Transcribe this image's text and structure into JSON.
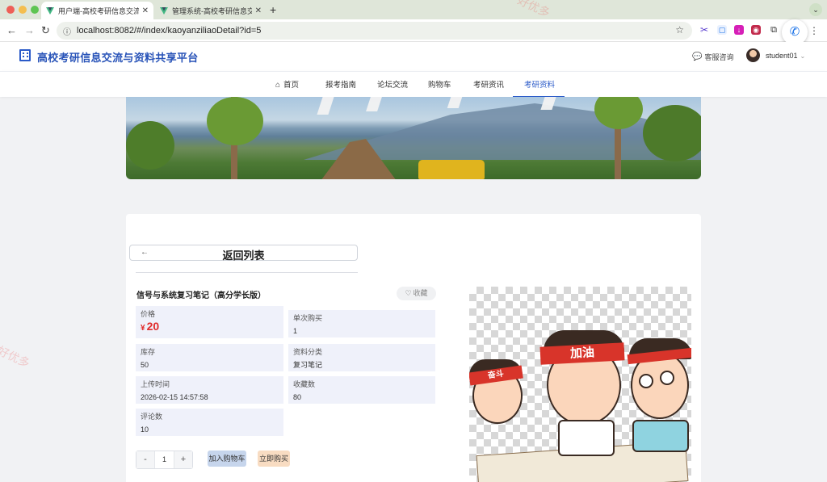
{
  "browser": {
    "tabs": [
      {
        "title": "用户端-高校考研信息交流与资料",
        "active": true
      },
      {
        "title": "管理系统-高校考研信息交流与资",
        "active": false
      }
    ],
    "new_tab_icon": "+",
    "url": "localhost:8082/#/index/kaoyanziliaoDetail?id=5",
    "icons": [
      "back-icon",
      "forward-icon",
      "reload-icon",
      "info-icon",
      "star-icon",
      "scissors-icon",
      "download-icon",
      "extension-icon",
      "puzzle-icon",
      "phone-icon",
      "menu-icon"
    ]
  },
  "header": {
    "brand_title": "高校考研信息交流与资料共享平台",
    "service_label": "客服咨询",
    "username": "student01"
  },
  "nav": {
    "items": [
      {
        "label": "首页"
      },
      {
        "label": "报考指南"
      },
      {
        "label": "论坛交流"
      },
      {
        "label": "购物车"
      },
      {
        "label": "考研资讯"
      },
      {
        "label": "考研资料"
      }
    ],
    "active_index": 5
  },
  "detail": {
    "back_label": "返回列表",
    "title": "信号与系统复习笔记（高分学长版）",
    "favorite_label": "收藏",
    "fields": {
      "price_label": "价格",
      "price_currency": "¥",
      "price_value": "20",
      "per_purchase_label": "单次购买",
      "per_purchase_value": "1",
      "stock_label": "库存",
      "stock_value": "50",
      "category_label": "资料分类",
      "category_value": "复习笔记",
      "upload_time_label": "上传时间",
      "upload_time_value": "2026-02-15 14:57:58",
      "favorites_label": "收藏数",
      "favorites_value": "80",
      "comments_label": "评论数",
      "comments_value": "10"
    },
    "quantity": {
      "minus": "-",
      "value": "1",
      "plus": "+"
    },
    "add_to_cart_label": "加入购物车",
    "buy_now_label": "立即购买",
    "cover_band_texts": [
      "加油",
      "奋斗"
    ]
  },
  "watermark_text": "好优多",
  "colors": {
    "brand_blue": "#2a5ac8",
    "price_red": "#e02b2b",
    "field_bg": "#eff1fa",
    "cart_btn_bg": "#c6d5ec",
    "buy_btn_bg": "#f8dcc2"
  }
}
